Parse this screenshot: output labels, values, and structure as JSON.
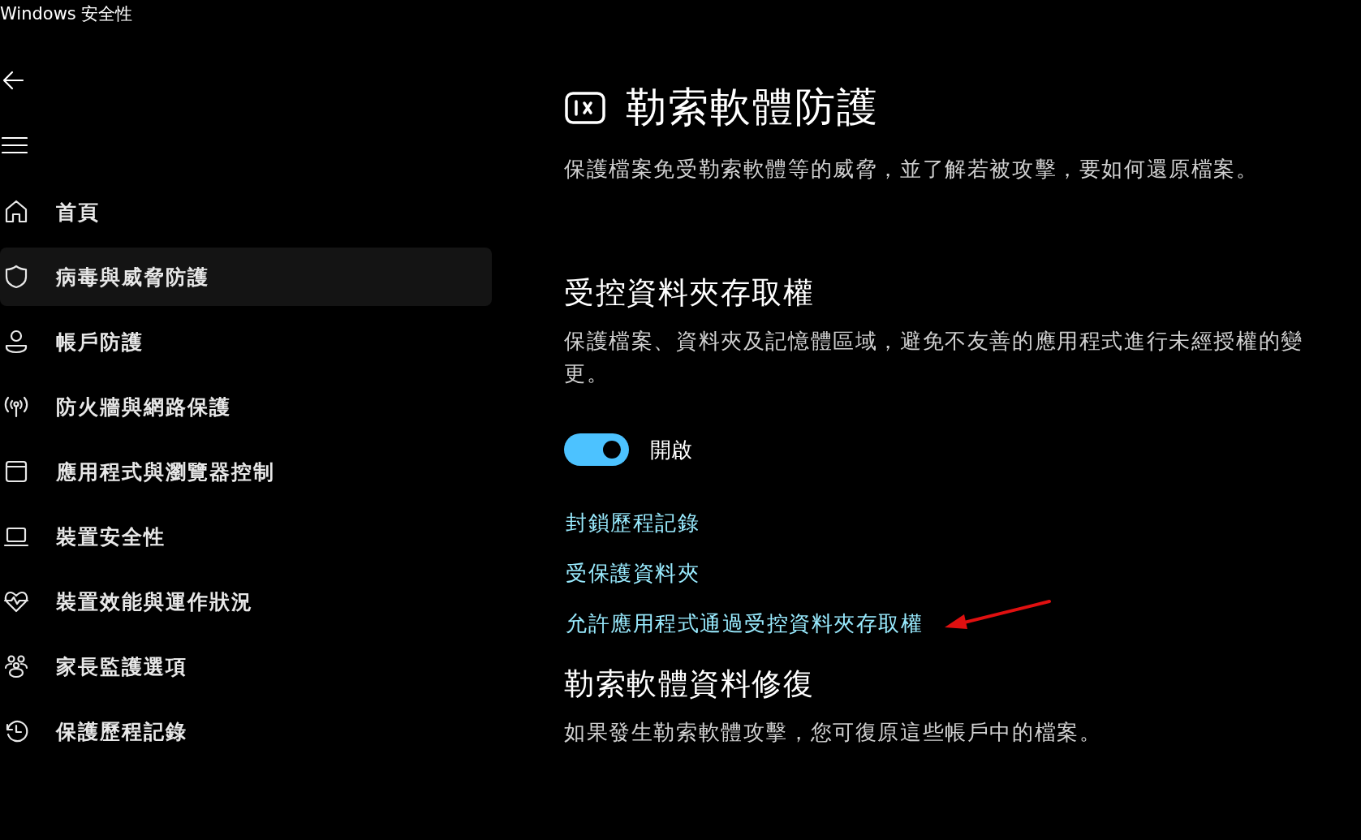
{
  "window": {
    "title": "Windows 安全性"
  },
  "sidebar": {
    "items": [
      {
        "label": "首頁",
        "selected": false
      },
      {
        "label": "病毒與威脅防護",
        "selected": true
      },
      {
        "label": "帳戶防護",
        "selected": false
      },
      {
        "label": "防火牆與網路保護",
        "selected": false
      },
      {
        "label": "應用程式與瀏覽器控制",
        "selected": false
      },
      {
        "label": "裝置安全性",
        "selected": false
      },
      {
        "label": "裝置效能與運作狀況",
        "selected": false
      },
      {
        "label": "家長監護選項",
        "selected": false
      },
      {
        "label": "保護歷程記錄",
        "selected": false
      }
    ]
  },
  "page": {
    "title": "勒索軟體防護",
    "description": "保護檔案免受勒索軟體等的威脅，並了解若被攻擊，要如何還原檔案。"
  },
  "sections": [
    {
      "heading": "受控資料夾存取權",
      "description": "保護檔案、資料夾及記憶體區域，避免不友善的應用程式進行未經授權的變更。",
      "toggle": {
        "on": true,
        "label": "開啟"
      },
      "links": [
        "封鎖歷程記錄",
        "受保護資料夾",
        "允許應用程式通過受控資料夾存取權"
      ]
    },
    {
      "heading": "勒索軟體資料修復",
      "description": "如果發生勒索軟體攻擊，您可復原這些帳戶中的檔案。"
    }
  ]
}
